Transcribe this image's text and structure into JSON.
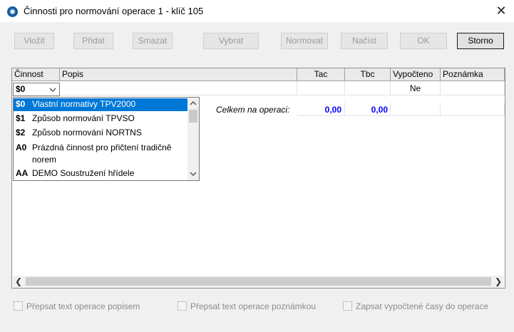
{
  "window": {
    "title": "Činnosti pro normování operace 1 - klíč 105",
    "close_glyph": "✕"
  },
  "toolbar": {
    "buttons": [
      {
        "label": "Vložit",
        "enabled": false
      },
      {
        "label": "Přidat",
        "enabled": false
      },
      {
        "label": "Smazat",
        "enabled": false
      },
      {
        "label": "Vybrat",
        "enabled": false
      },
      {
        "label": "Normovat",
        "enabled": false
      },
      {
        "label": "Načíst",
        "enabled": false
      },
      {
        "label": "OK",
        "enabled": false
      },
      {
        "label": "Storno",
        "enabled": true
      }
    ]
  },
  "grid": {
    "columns": [
      "Činnost",
      "Popis",
      "Tac",
      "Tbc",
      "Vypočteno",
      "Poznámka"
    ],
    "row": {
      "cinnost": "$0",
      "vypocteno": "Ne"
    },
    "summary": {
      "label": "Celkem na operaci:",
      "tac": "0,00",
      "tbc": "0,00"
    },
    "dropdown": {
      "selected_index": 0,
      "items": [
        {
          "code": "$0",
          "label": "Vlastní normativy TPV2000"
        },
        {
          "code": "$1",
          "label": "Způsob normování TPVSO"
        },
        {
          "code": "$2",
          "label": "Způsob normování NORTNS"
        },
        {
          "code": "A0",
          "label": "Prázdná činnost pro přičtení tradičně norem"
        },
        {
          "code": "AA",
          "label": "DEMO Soustružení hřídele"
        }
      ]
    }
  },
  "checkboxes": [
    {
      "label": "Přepsat text operace popisem",
      "checked": false
    },
    {
      "label": "Přepsat text operace poznámkou",
      "checked": false
    },
    {
      "label": "Zapsat vypočtené časy do operace",
      "checked": false
    }
  ],
  "colors": {
    "selection": "#0078d7",
    "sum_values": "#0000ff"
  }
}
